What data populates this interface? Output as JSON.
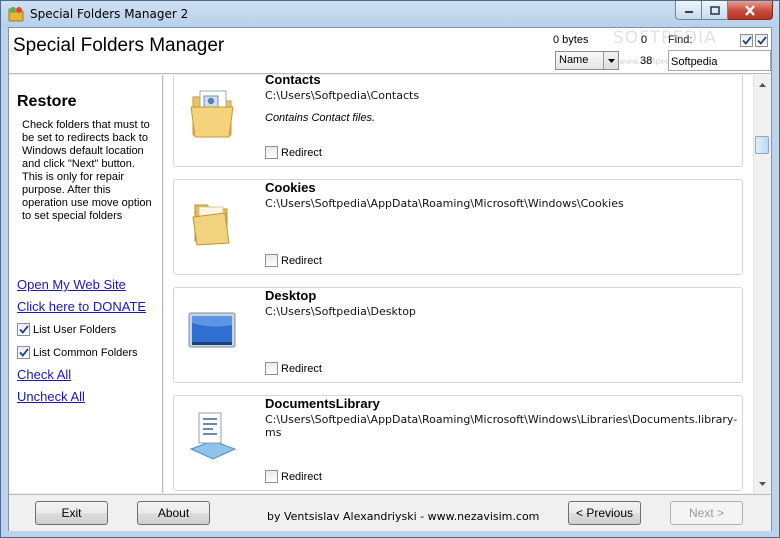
{
  "window": {
    "title": "Special Folders Manager 2"
  },
  "header": {
    "app_title": "Special Folders Manager",
    "bytes_label": "0 bytes",
    "count_top": "0",
    "count_bottom": "38",
    "find_label": "Find:",
    "sort_value": "Name",
    "find_value": "Softpedia",
    "watermark": "SOFTPEDIA",
    "watermark_url": "www.softpedia.com"
  },
  "sidebar": {
    "title": "Restore",
    "description": "Check folders that must to be set to redirects back to Windows default location and click \"Next\" button. This is only for repair purpose. After this operation use move option to set special folders",
    "link_web_site": "Open My Web Site",
    "link_donate": "Click here to DONATE",
    "check_user_folders": "List User Folders",
    "check_common_folders": "List Common Folders",
    "link_check_all": "Check All",
    "link_uncheck_all": "Uncheck All"
  },
  "folders": [
    {
      "name": "Contacts",
      "path": "C:\\Users\\Softpedia\\Contacts",
      "description": "Contains Contact files.",
      "redirect_label": "Redirect",
      "icon": "contacts-folder-icon"
    },
    {
      "name": "Cookies",
      "path": "C:\\Users\\Softpedia\\AppData\\Roaming\\Microsoft\\Windows\\Cookies",
      "description": "",
      "redirect_label": "Redirect",
      "icon": "folder-icon"
    },
    {
      "name": "Desktop",
      "path": "C:\\Users\\Softpedia\\Desktop",
      "description": "",
      "redirect_label": "Redirect",
      "icon": "desktop-icon"
    },
    {
      "name": "DocumentsLibrary",
      "path": "C:\\Users\\Softpedia\\AppData\\Roaming\\Microsoft\\Windows\\Libraries\\Documents.library-ms",
      "description": "",
      "redirect_label": "Redirect",
      "icon": "documents-library-icon"
    }
  ],
  "footer": {
    "exit_label": "Exit",
    "about_label": "About",
    "credit": "by Ventsislav Alexandriyski - www.nezavisim.com",
    "previous_label": "< Previous",
    "next_label": "Next >"
  },
  "colors": {
    "link": "#1a1ab0",
    "frame": "#bcd3ea",
    "close_button": "#c74b3b"
  }
}
